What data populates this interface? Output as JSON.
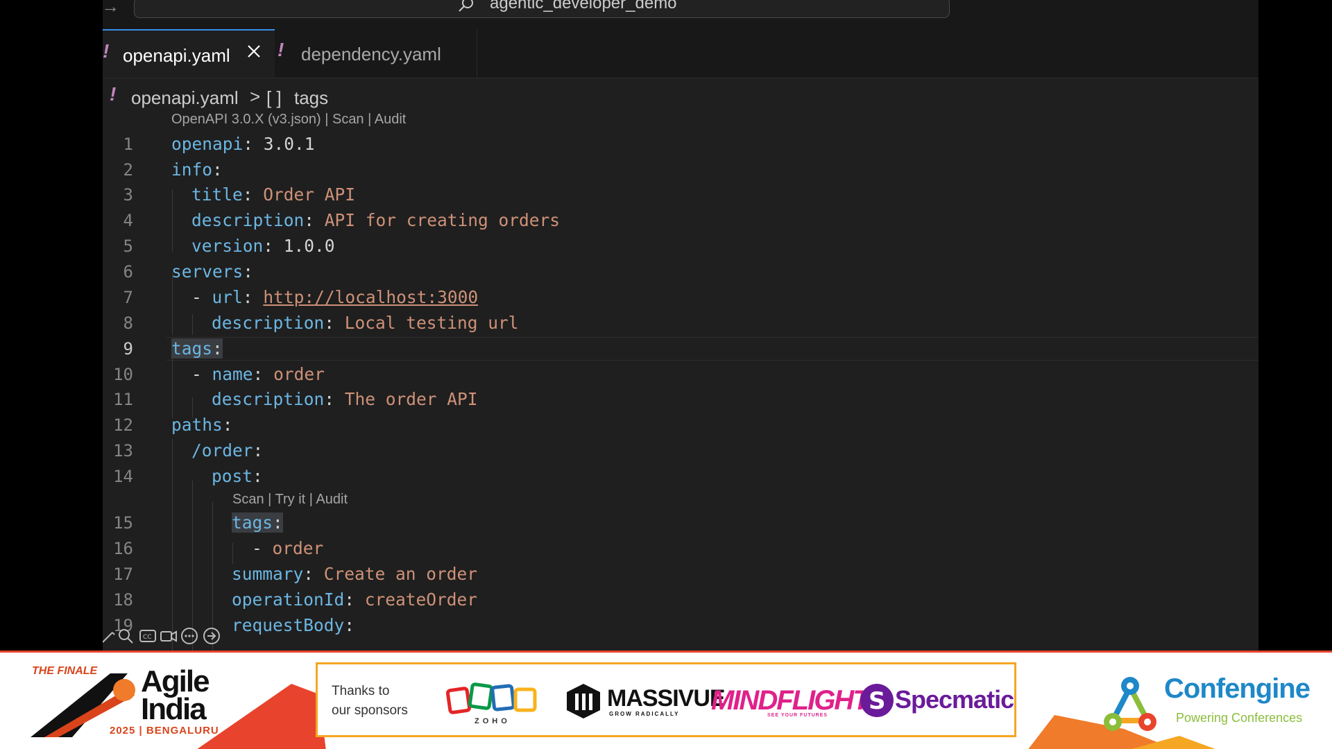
{
  "window": {
    "command_center": "agentic_developer_demo"
  },
  "tabs": [
    {
      "label": "openapi.yaml",
      "warning_glyph": "!",
      "active": true
    },
    {
      "label": "dependency.yaml",
      "warning_glyph": "!",
      "active": false
    }
  ],
  "breadcrumb": {
    "warning_glyph": "!",
    "file": "openapi.yaml",
    "separator": ">",
    "symbol_icon": "[ ]",
    "item": "tags"
  },
  "codelens": {
    "top": "OpenAPI 3.0.X (v3.json) | Scan | Audit",
    "post": "Scan | Try it | Audit"
  },
  "line_numbers": [
    "1",
    "2",
    "3",
    "4",
    "5",
    "6",
    "7",
    "8",
    "9",
    "10",
    "11",
    "12",
    "13",
    "14",
    "15",
    "16",
    "17",
    "18",
    "19"
  ],
  "active_line": "9",
  "code": {
    "l1": {
      "key": "openapi",
      "value": "3.0.1"
    },
    "l2": {
      "key": "info"
    },
    "l3": {
      "key": "title",
      "value": "Order API"
    },
    "l4": {
      "key": "description",
      "value": "API for creating orders"
    },
    "l5": {
      "key": "version",
      "value": "1.0.0"
    },
    "l6": {
      "key": "servers"
    },
    "l7": {
      "dash": "-",
      "key": "url",
      "value": "http://localhost:3000"
    },
    "l8": {
      "key": "description",
      "value": "Local testing url"
    },
    "l9": {
      "key": "tags"
    },
    "l10": {
      "dash": "-",
      "key": "name",
      "value": "order"
    },
    "l11": {
      "key": "description",
      "value": "The order API"
    },
    "l12": {
      "key": "paths"
    },
    "l13": {
      "key": "/order"
    },
    "l14": {
      "key": "post"
    },
    "l15": {
      "key": "tags"
    },
    "l16": {
      "dash": "-",
      "value": "order"
    },
    "l17": {
      "key": "summary",
      "value": "Create an order"
    },
    "l18": {
      "key": "operationId",
      "value": "createOrder"
    },
    "l19": {
      "key": "requestBody"
    },
    "colon": ":"
  },
  "toolbar_icons": [
    "pencil-icon",
    "zoom-icon",
    "captions-icon",
    "camera-icon",
    "more-icon",
    "forward-icon"
  ],
  "banner": {
    "finale_label": "THE FINALE",
    "event_word_1": "Agile",
    "event_word_2": "India",
    "event_year": "2025 | BENGALURU",
    "thanks_line_1": "Thanks to",
    "thanks_line_2": "our sponsors",
    "sponsors": {
      "zoho": "ZOHO",
      "massivue": "MASSIVUE",
      "massivue_tagline": "GROW RADICALLY",
      "mindflight": "MINDFLIGHT7",
      "mindflight_tagline": "SEE YOUR FUTURES",
      "specmatic": "Specmatic"
    },
    "confengine": "Confengine",
    "confengine_tagline": "Powering Conferences",
    "colors": {
      "accent_red": "#e8432c",
      "accent_orange": "#f5a623",
      "confengine_blue": "#1e88c8",
      "confengine_green": "#8bbd3b",
      "mindflight_pink": "#e0218a",
      "specmatic_purple": "#6a1b9a"
    }
  },
  "editor_colors": {
    "key": "#6cb6e3",
    "string": "#ce9178",
    "background": "#1f1f1f",
    "tab_accent": "#3b8eea",
    "warning": "#c586c0"
  }
}
